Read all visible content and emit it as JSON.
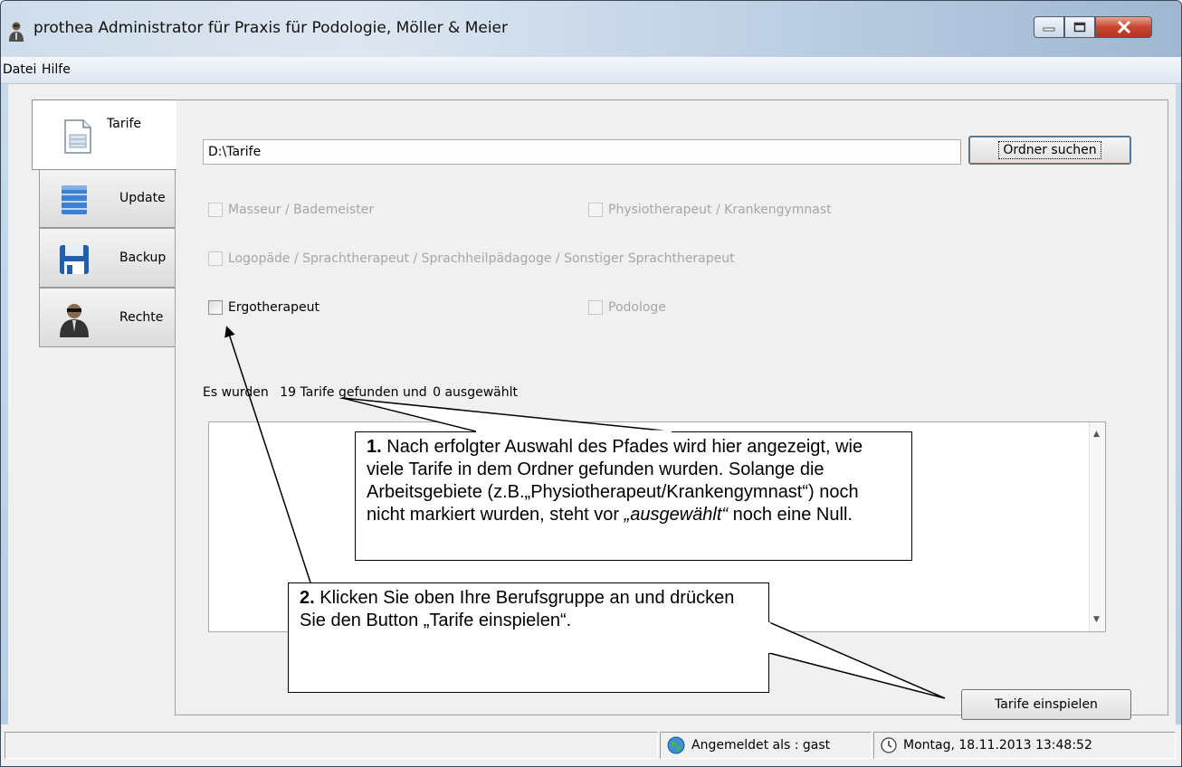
{
  "window": {
    "title": "prothea Administrator für Praxis für Podologie, Möller & Meier"
  },
  "menu": {
    "items": [
      "Datei",
      "Hilfe"
    ]
  },
  "tabs": [
    {
      "label": "Tarife",
      "icon": "document-icon",
      "active": true
    },
    {
      "label": "Update",
      "icon": "database-icon",
      "active": false
    },
    {
      "label": "Backup",
      "icon": "floppy-disk-icon",
      "active": false
    },
    {
      "label": "Rechte",
      "icon": "user-sunglasses-icon",
      "active": false
    }
  ],
  "tarife": {
    "path_value": "D:\\Tarife",
    "search_button": "Ordner suchen",
    "checkboxes": [
      {
        "label": "Masseur / Bademeister",
        "enabled": false,
        "checked": false
      },
      {
        "label": "Physiotherapeut / Krankengymnast",
        "enabled": false,
        "checked": false
      },
      {
        "label": "Logopäde / Sprachtherapeut / Sprachheilpädagoge / Sonstiger Sprachtherapeut",
        "enabled": false,
        "checked": false
      },
      {
        "label": "Ergotherapeut",
        "enabled": true,
        "checked": false
      },
      {
        "label": "Podologe",
        "enabled": false,
        "checked": false
      }
    ],
    "count_prefix": "Es wurden",
    "found_count": "19",
    "count_middle": "Tarife gefunden und",
    "selected_count": "0",
    "count_suffix": "ausgewählt",
    "import_button": "Tarife einspielen"
  },
  "statusbar": {
    "left_text": "",
    "login_text": "Angemeldet als : gast",
    "datetime_text": "Montag, 18.11.2013  13:48:52"
  },
  "callouts": {
    "c1_number": "1.",
    "c1_text_a": " Nach erfolgter Auswahl des Pfades wird hier angezeigt, wie viele Tarife in dem Ordner gefunden wurden. Solange die Arbeitsgebiete (z.B.„Physiotherapeut/Krankengymnast“) noch nicht markiert wurden, steht vor ",
    "c1_italic": "„ausgewählt“",
    "c1_text_b": " noch eine Null.",
    "c2_number": "2.",
    "c2_text": " Klicken Sie oben Ihre Berufsgruppe an und drücken Sie den Button „Tarife einspielen“."
  },
  "colors": {
    "close_button": "#c9452f",
    "titlebar": "#cfdcea",
    "disabled_text": "#a6a6a6"
  }
}
